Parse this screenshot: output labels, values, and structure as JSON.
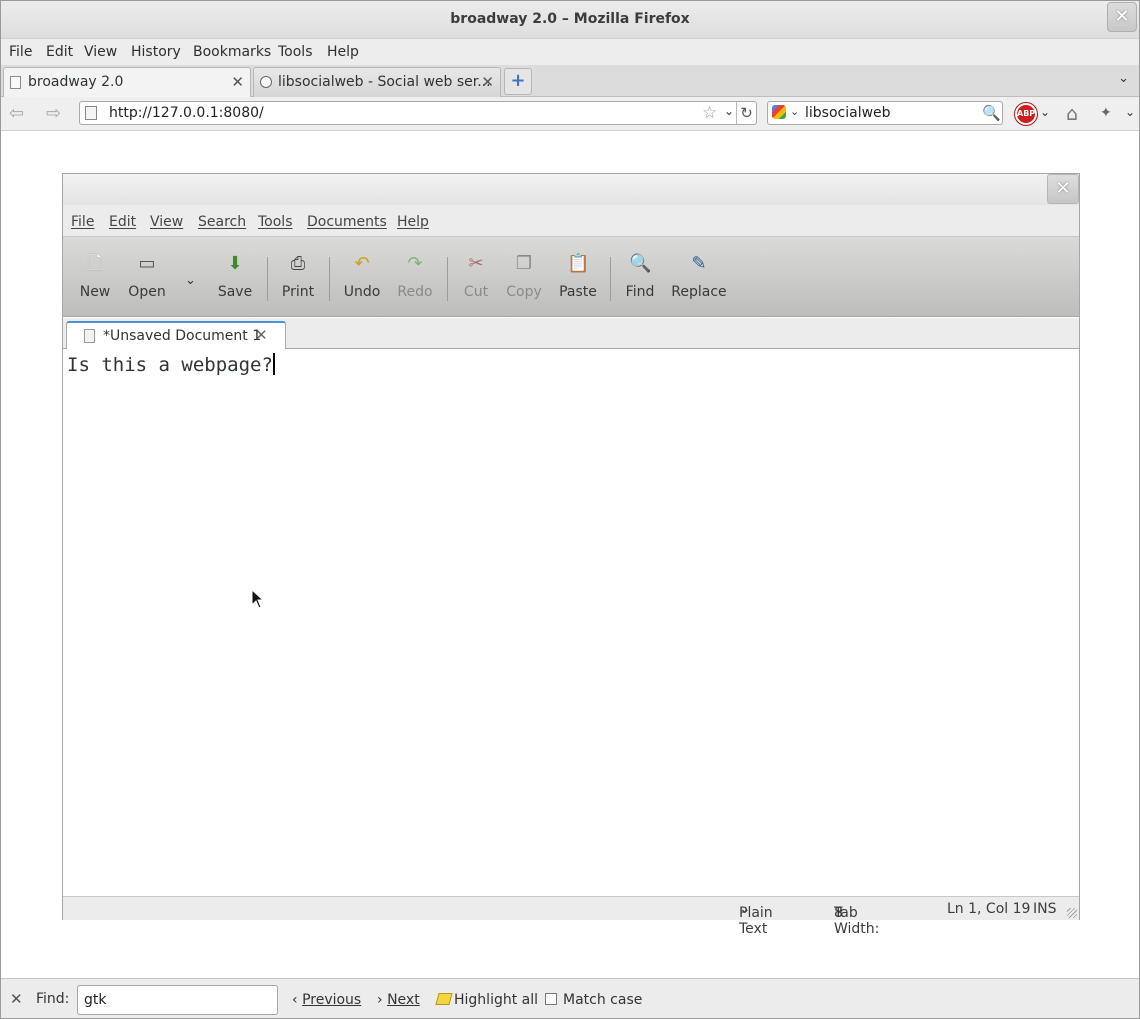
{
  "window": {
    "title": "broadway 2.0 – Mozilla Firefox"
  },
  "menubar": [
    "File",
    "Edit",
    "View",
    "History",
    "Bookmarks",
    "Tools",
    "Help"
  ],
  "tabs": [
    {
      "label": "broadway 2.0",
      "active": true
    },
    {
      "label": "libsocialweb - Social web ser...",
      "active": false
    }
  ],
  "navbar": {
    "url": "http://127.0.0.1:8080/",
    "search_value": "libsocialweb",
    "adblock_label": "ABP"
  },
  "gedit": {
    "menubar": [
      "File",
      "Edit",
      "View",
      "Search",
      "Tools",
      "Documents",
      "Help"
    ],
    "toolbar": {
      "new": "New",
      "open": "Open",
      "save": "Save",
      "print": "Print",
      "undo": "Undo",
      "redo": "Redo",
      "cut": "Cut",
      "copy": "Copy",
      "paste": "Paste",
      "find": "Find",
      "replace": "Replace"
    },
    "document_tab": "*Unsaved Document 1",
    "editor_text": "Is this a webpage?",
    "statusbar": {
      "language": "Plain Text",
      "tab_width_label": "Tab Width:",
      "tab_width_value": "8",
      "position": "Ln 1, Col 19",
      "mode": "INS"
    }
  },
  "findbar": {
    "label": "Find:",
    "value": "gtk",
    "previous": "Previous",
    "next": "Next",
    "highlight_all": "Highlight all",
    "match_case": "Match case"
  },
  "icons": {
    "firefox_close": "close-icon",
    "back": "back-arrow-icon",
    "forward": "forward-arrow-icon",
    "bookmark": "star-icon",
    "reload": "reload-icon",
    "search": "magnifier-icon",
    "home": "home-icon"
  },
  "colors": {
    "tab_accent": "#4a90d9",
    "adblock_red": "#d01e1e",
    "toolbar_gradient_top": "#dadad9",
    "toolbar_gradient_bottom": "#bdbdbb"
  }
}
